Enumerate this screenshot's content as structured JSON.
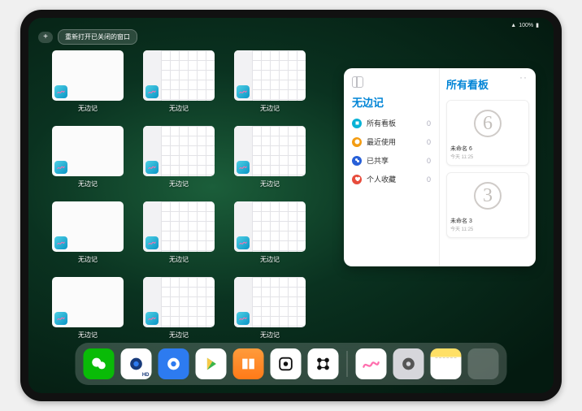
{
  "status": {
    "wifi": "􀙇",
    "battery_pct": "100%"
  },
  "controls": {
    "add_label": "+",
    "reopen_label": "重新打开已关闭的窗口"
  },
  "app_windows": [
    {
      "label": "无边记",
      "preview": "blank"
    },
    {
      "label": "无边记",
      "preview": "grid"
    },
    {
      "label": "无边记",
      "preview": "grid"
    },
    {
      "label": "无边记",
      "preview": "blank"
    },
    {
      "label": "无边记",
      "preview": "grid"
    },
    {
      "label": "无边记",
      "preview": "grid"
    },
    {
      "label": "无边记",
      "preview": "blank"
    },
    {
      "label": "无边记",
      "preview": "grid"
    },
    {
      "label": "无边记",
      "preview": "grid"
    },
    {
      "label": "无边记",
      "preview": "blank"
    },
    {
      "label": "无边记",
      "preview": "grid"
    },
    {
      "label": "无边记",
      "preview": "grid"
    }
  ],
  "panel": {
    "left_title": "无边记",
    "items": [
      {
        "label": "所有看板",
        "count": "0",
        "color": "#08b2d6"
      },
      {
        "label": "最近使用",
        "count": "0",
        "color": "#f39c12"
      },
      {
        "label": "已共享",
        "count": "0",
        "color": "#2860d8"
      },
      {
        "label": "个人收藏",
        "count": "0",
        "color": "#e74c3c"
      }
    ],
    "right_title": "所有看板",
    "boards": [
      {
        "digit": "6",
        "name": "未命名 6",
        "sub": "今天 11:25"
      },
      {
        "digit": "3",
        "name": "未命名 3",
        "sub": "今天 11:25"
      }
    ]
  },
  "dock": [
    {
      "name": "wechat",
      "bg": "#09bb07",
      "glyph": "chat"
    },
    {
      "name": "quark-hd",
      "bg": "#ffffff",
      "glyph": "quark-blue"
    },
    {
      "name": "quark",
      "bg": "#2d7bf0",
      "glyph": "quark-white"
    },
    {
      "name": "play",
      "bg": "#ffffff",
      "glyph": "play"
    },
    {
      "name": "books",
      "bg": "linear-gradient(#ff9b3b,#ff7a18)",
      "glyph": "books"
    },
    {
      "name": "dice",
      "bg": "#ffffff",
      "glyph": "dice"
    },
    {
      "name": "connect",
      "bg": "#ffffff",
      "glyph": "dots"
    },
    {
      "name": "sep"
    },
    {
      "name": "freeform",
      "bg": "#ffffff",
      "glyph": "scribble"
    },
    {
      "name": "settings",
      "bg": "#d6d6db",
      "glyph": "gear"
    },
    {
      "name": "notes",
      "bg": "#ffffff",
      "glyph": "notes"
    },
    {
      "name": "library",
      "bg": "grid",
      "glyph": "grid"
    }
  ]
}
